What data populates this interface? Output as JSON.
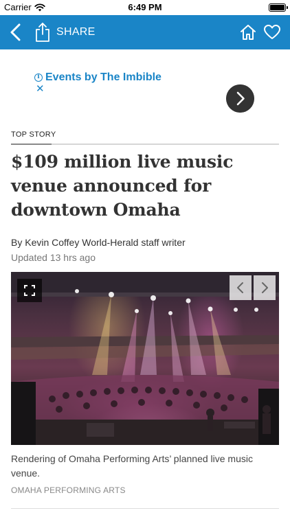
{
  "status_bar": {
    "carrier": "Carrier",
    "time": "6:49 PM",
    "icons": [
      "wifi-icon",
      "battery-icon"
    ]
  },
  "nav_bar": {
    "background": "#1a85c7",
    "share_label": "SHARE",
    "icons": [
      "back-chevron-icon",
      "share-icon",
      "home-icon",
      "heart-icon"
    ]
  },
  "ad": {
    "title": "Events by The Imbible",
    "icons": [
      "info-icon",
      "close-icon",
      "chevron-right-icon"
    ]
  },
  "article": {
    "kicker": "TOP STORY",
    "headline": "$109 million live music venue announced for downtown Omaha",
    "byline": "By Kevin Coffey World-Herald staff writer",
    "updated": "Updated 13 hrs ago"
  },
  "photo": {
    "caption": "Rendering of Omaha Performing Arts’ planned live music venue.",
    "credit": "OMAHA PERFORMING ARTS",
    "icons": [
      "expand-icon",
      "chevron-left-icon",
      "chevron-right-icon"
    ]
  }
}
